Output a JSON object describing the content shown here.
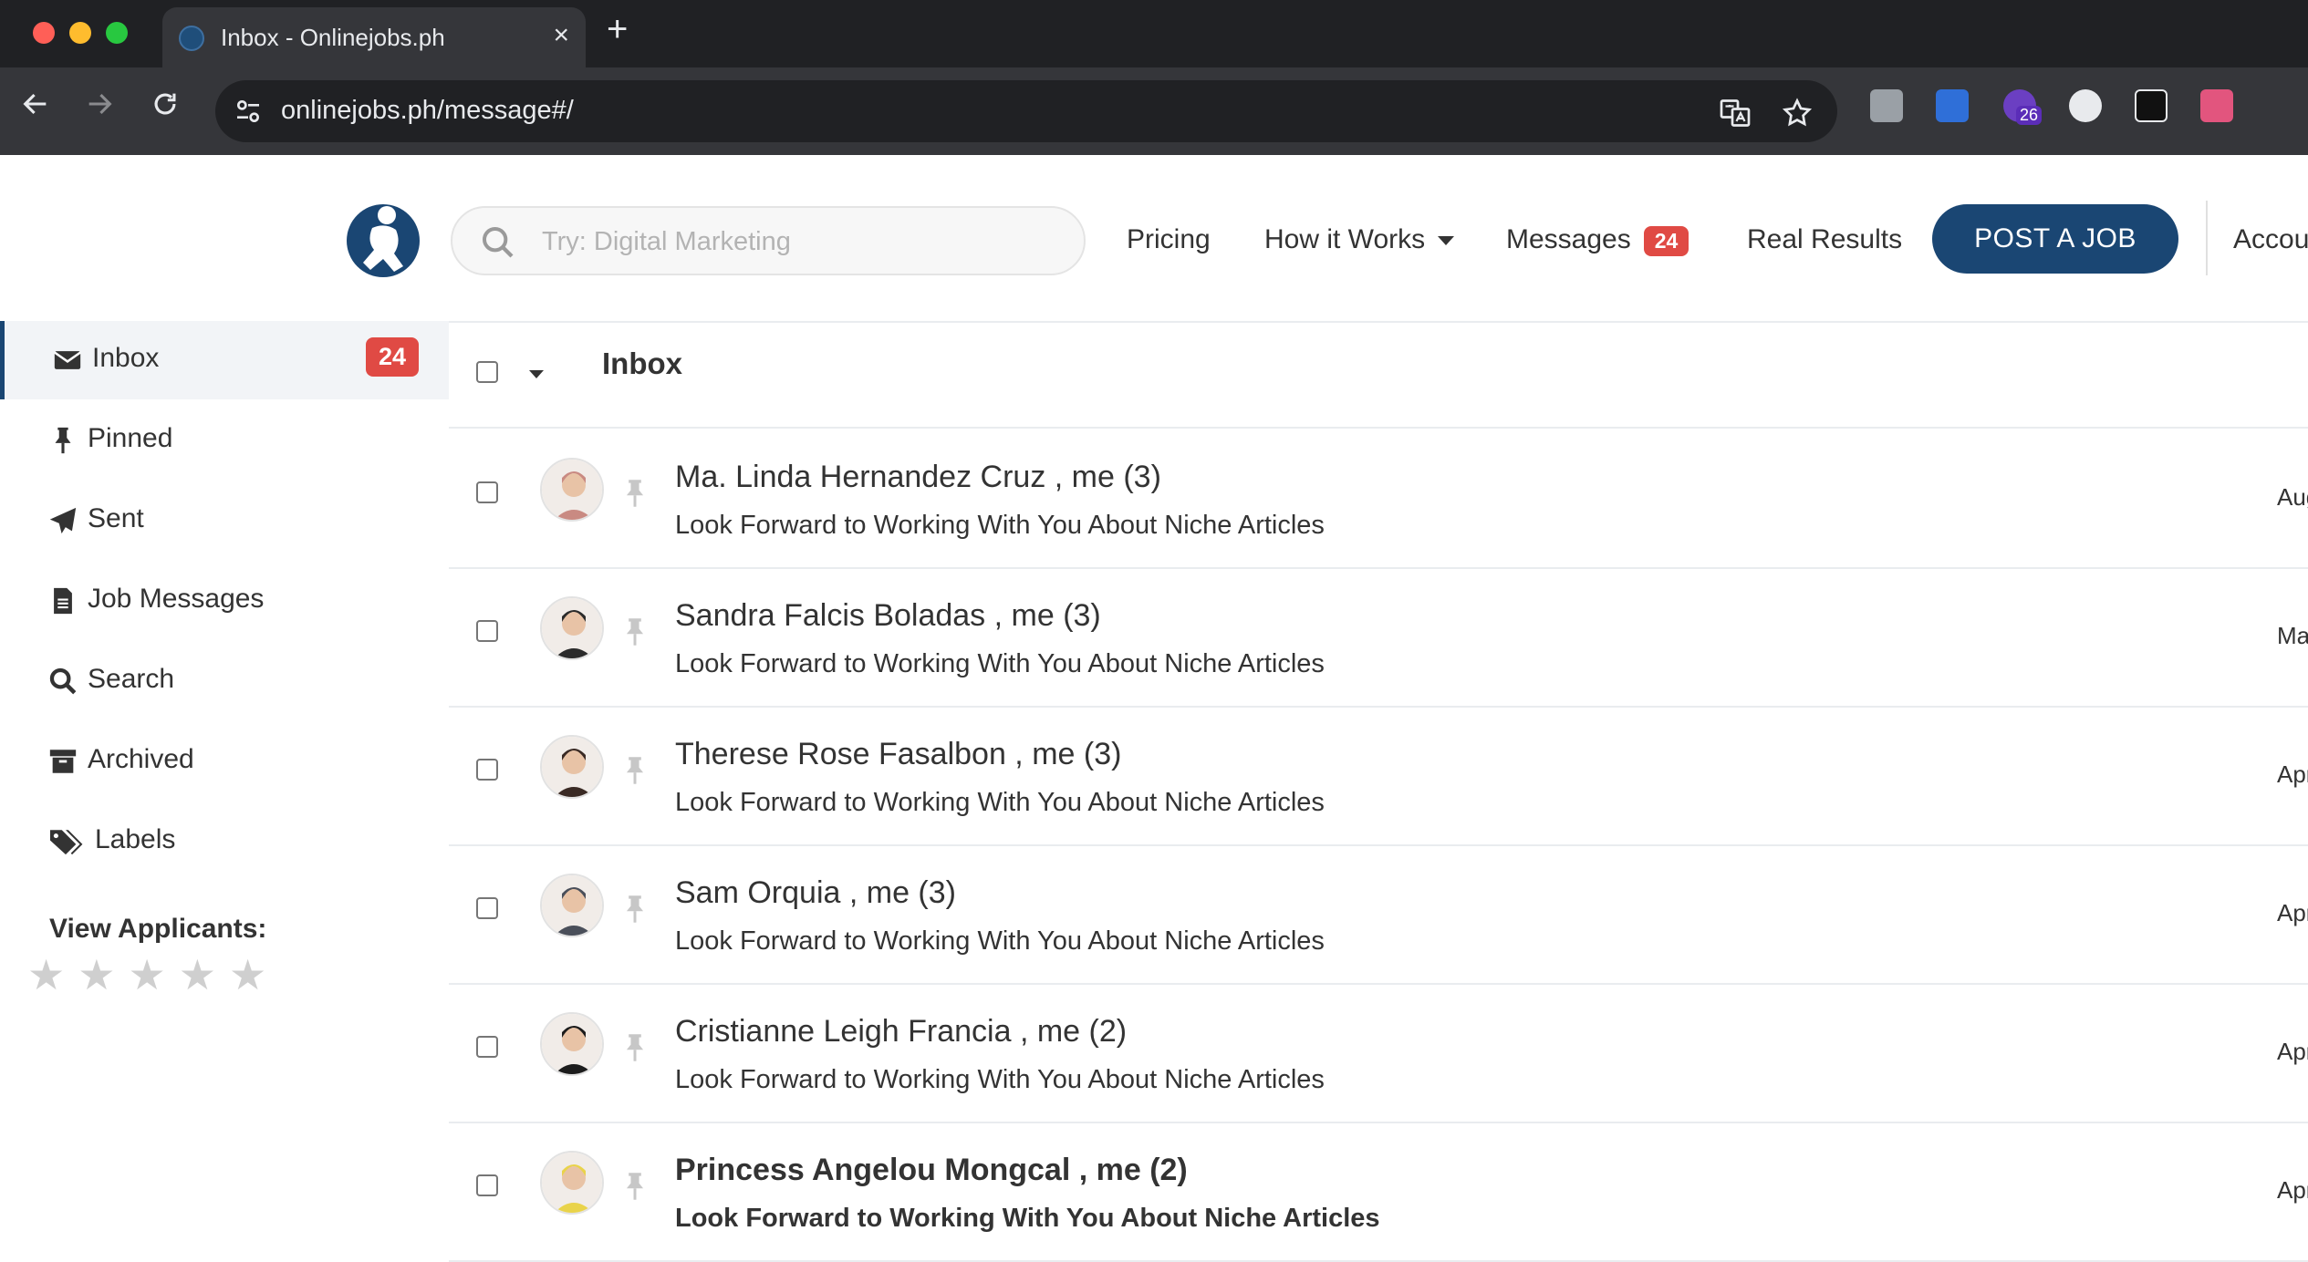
{
  "browser": {
    "tab_title": "Inbox - Onlinejobs.ph",
    "tab_close": "×",
    "new_tab": "+",
    "url_domain": "onlinejobs.ph",
    "url_path": "/message#/",
    "extension_badge": "26"
  },
  "header": {
    "search_placeholder": "Try: Digital Marketing",
    "nav": {
      "pricing": "Pricing",
      "how_it_works": "How it Works",
      "messages": "Messages",
      "messages_count": "24",
      "real_results": "Real Results",
      "post_job": "POST A JOB",
      "account": "Accou"
    }
  },
  "sidebar": {
    "items": [
      {
        "label": "Inbox",
        "icon": "envelope-icon",
        "badge": "24"
      },
      {
        "label": "Pinned",
        "icon": "pin-icon"
      },
      {
        "label": "Sent",
        "icon": "paper-plane-icon"
      },
      {
        "label": "Job Messages",
        "icon": "file-icon"
      },
      {
        "label": "Search",
        "icon": "search-icon"
      },
      {
        "label": "Archived",
        "icon": "archive-icon"
      },
      {
        "label": "Labels",
        "icon": "tags-icon"
      }
    ],
    "view_applicants": "View Applicants:",
    "stars": [
      "★",
      "★",
      "★",
      "★",
      "★"
    ]
  },
  "inbox": {
    "title": "Inbox",
    "messages": [
      {
        "sender": "Ma. Linda Hernandez Cruz , me (3)",
        "subject": "Look Forward to Working With You About Niche Articles",
        "date": "Aug",
        "unread": false,
        "avatar_color": "#c98a82"
      },
      {
        "sender": "Sandra Falcis Boladas , me (3)",
        "subject": "Look Forward to Working With You About Niche Articles",
        "date": "Ma",
        "unread": false,
        "avatar_color": "#2b2b2b"
      },
      {
        "sender": "Therese Rose Fasalbon , me (3)",
        "subject": "Look Forward to Working With You About Niche Articles",
        "date": "Apr",
        "unread": false,
        "avatar_color": "#3a2a24"
      },
      {
        "sender": "Sam Orquia , me (3)",
        "subject": "Look Forward to Working With You About Niche Articles",
        "date": "Apr",
        "unread": false,
        "avatar_color": "#4a4f5a"
      },
      {
        "sender": "Cristianne Leigh Francia , me (2)",
        "subject": "Look Forward to Working With You About Niche Articles",
        "date": "Apr",
        "unread": false,
        "avatar_color": "#1c1c1c"
      },
      {
        "sender": "Princess Angelou Mongcal , me (2)",
        "subject": "Look Forward to Working With You About Niche Articles",
        "date": "Apr",
        "unread": true,
        "avatar_color": "#e9d34a"
      }
    ]
  }
}
